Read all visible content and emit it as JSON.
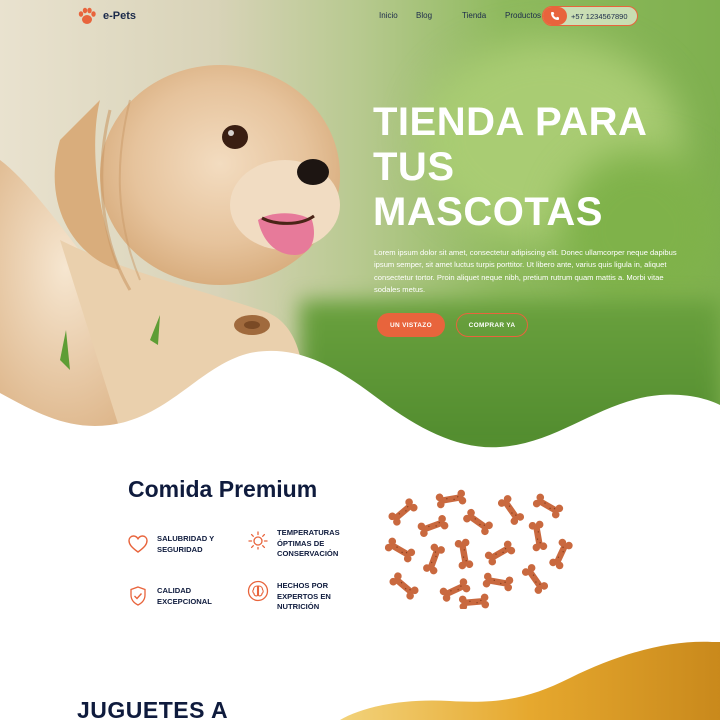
{
  "header": {
    "logo_text": "e-Pets",
    "nav": [
      "Inicio",
      "Blog",
      "Tienda",
      "Productos"
    ],
    "phone": "+57 1234567890"
  },
  "hero": {
    "title": "TIENDA PARA TUS MASCOTAS",
    "description": "Lorem ipsum dolor sit amet, consectetur adipiscing elit. Donec ullamcorper neque dapibus ipsum semper, sit amet luctus turpis porttitor. Ut libero ante, varius quis ligula in, aliquet consectetur tortor. Proin aliquet neque nibh, pretium rutrum quam mattis a. Morbi vitae sodales metus.",
    "primary_button": "UN VISTAZO",
    "secondary_button": "COMPRAR YA"
  },
  "premium": {
    "title": "Comida Premium",
    "features": [
      {
        "label": "SALUBRIDAD Y SEGURIDAD",
        "icon": "heart-icon"
      },
      {
        "label": "TEMPERATURAS ÓPTIMAS DE CONSERVACIÓN",
        "icon": "sun-icon"
      },
      {
        "label": "CALIDAD EXCEPCIONAL",
        "icon": "shield-check-icon"
      },
      {
        "label": "HECHOS POR EXPERTOS EN NUTRICIÓN",
        "icon": "brain-icon"
      }
    ]
  },
  "toys": {
    "title": "JUGUETES A"
  },
  "colors": {
    "accent": "#e8643c",
    "navy": "#0f1b3d",
    "gold": "#e0a12a"
  }
}
